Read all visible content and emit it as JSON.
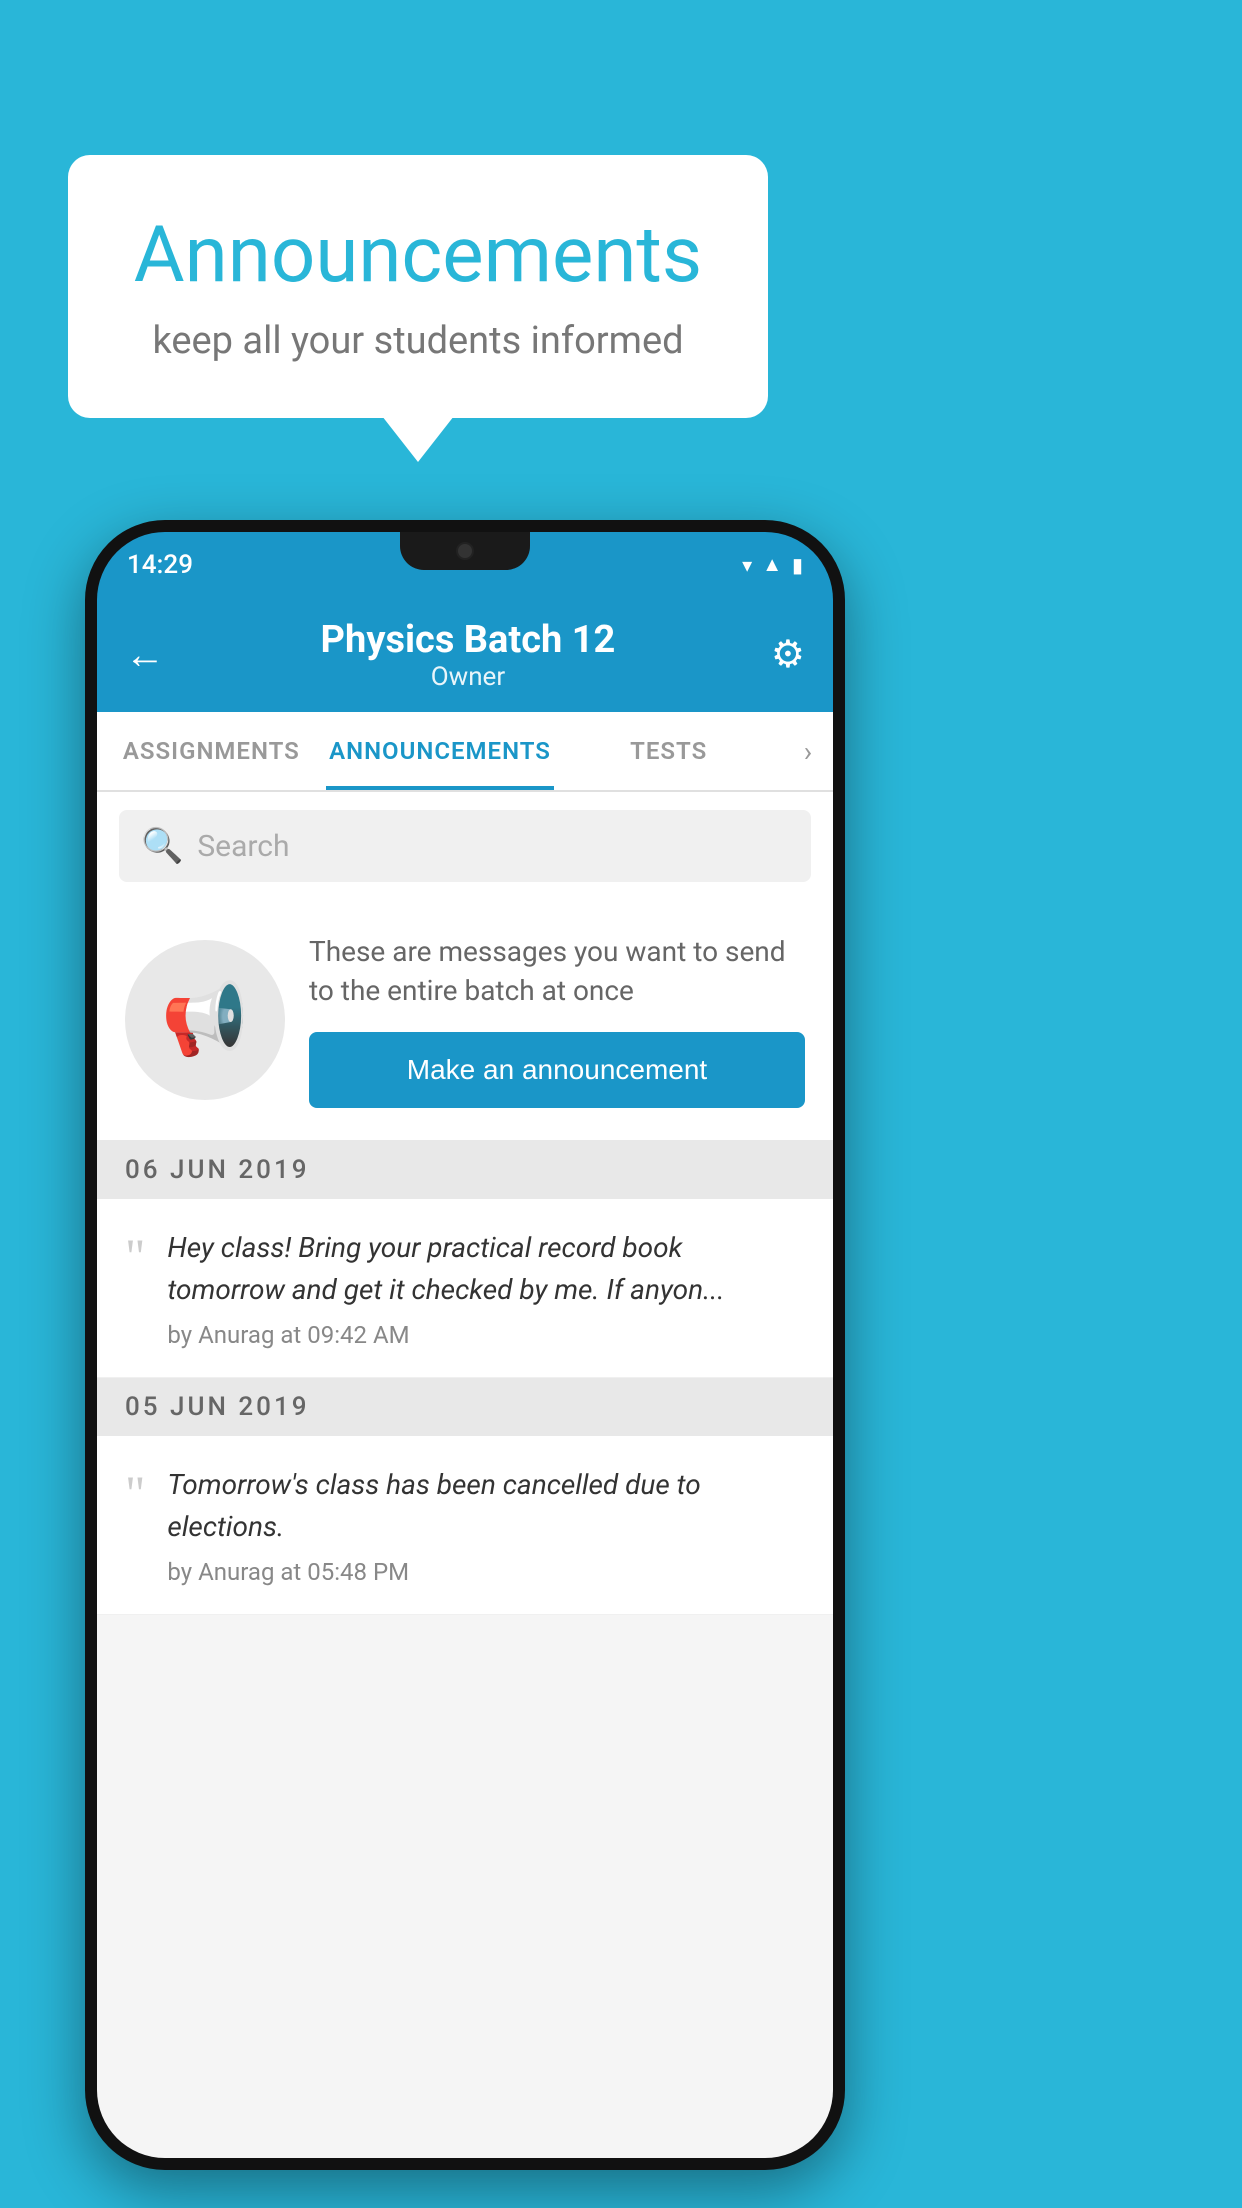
{
  "page": {
    "background_color": "#29b6d8"
  },
  "speech_bubble": {
    "title": "Announcements",
    "subtitle": "keep all your students informed"
  },
  "phone": {
    "status_bar": {
      "time": "14:29",
      "icons": [
        "wifi",
        "signal",
        "battery"
      ]
    },
    "header": {
      "back_label": "←",
      "title": "Physics Batch 12",
      "subtitle": "Owner",
      "gear_label": "⚙"
    },
    "tabs": [
      {
        "label": "ASSIGNMENTS",
        "active": false
      },
      {
        "label": "ANNOUNCEMENTS",
        "active": true
      },
      {
        "label": "TESTS",
        "active": false
      }
    ],
    "search": {
      "placeholder": "Search"
    },
    "promo_card": {
      "description": "These are messages you want to send to the entire batch at once",
      "button_label": "Make an announcement"
    },
    "announcements": [
      {
        "date": "06  JUN  2019",
        "message": "Hey class! Bring your practical record book tomorrow and get it checked by me. If anyon...",
        "author": "by Anurag at 09:42 AM"
      },
      {
        "date": "05  JUN  2019",
        "message": "Tomorrow's class has been cancelled due to elections.",
        "author": "by Anurag at 05:48 PM"
      }
    ]
  }
}
